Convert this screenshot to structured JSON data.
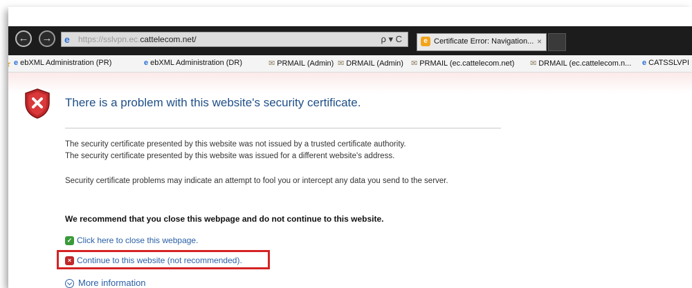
{
  "browser": {
    "url_prefix": "https://sslvpn.ec.",
    "url_domain": "cattelecom.net/",
    "search_refresh": "ρ ▾ C",
    "tab_title": "Certificate Error: Navigation...",
    "tab_close": "×"
  },
  "favorites": [
    {
      "label": "ebXML Administration (PR)",
      "icon": "ie-icon"
    },
    {
      "label": "ebXML Administration (DR)",
      "icon": "ie-icon"
    },
    {
      "label": "PRMAIL (Admin)",
      "icon": "mail-icon"
    },
    {
      "label": "DRMAIL (Admin)",
      "icon": "mail-icon"
    },
    {
      "label": "PRMAIL (ec.cattelecom.net)",
      "icon": "mail-icon"
    },
    {
      "label": "DRMAIL (ec.cattelecom.n...",
      "icon": "mail-icon"
    },
    {
      "label": "CATSSLVPI",
      "icon": "ie-icon"
    }
  ],
  "page": {
    "title": "There is a problem with this website's security certificate.",
    "para1_line1": "The security certificate presented by this website was not issued by a trusted certificate authority.",
    "para1_line2": "The security certificate presented by this website was issued for a different website's address.",
    "para2": "Security certificate problems may indicate an attempt to fool you or intercept any data you send to the server.",
    "recommend": "We recommend that you close this webpage and do not continue to this website.",
    "close_link": "Click here to close this webpage.",
    "continue_link": "Continue to this website (not recommended).",
    "more_info": "More information"
  },
  "colors": {
    "title": "#1f4f87",
    "link": "#2a5fa6",
    "highlight_box": "#d42323",
    "shield_red": "#c0282a",
    "green_icon": "#3a9a3a"
  }
}
